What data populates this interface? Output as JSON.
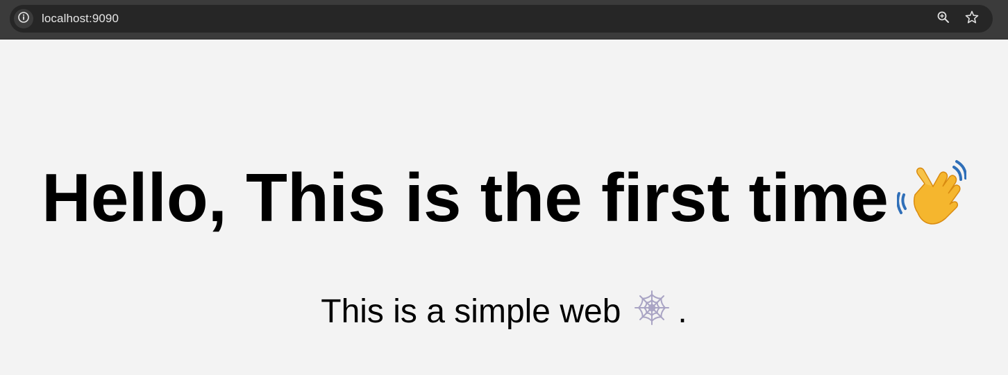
{
  "browser": {
    "url": "localhost:9090",
    "icons": {
      "site_info": "info-icon",
      "zoom": "zoom-in-icon",
      "bookmark": "star-icon"
    }
  },
  "page": {
    "heading": "Hello, This is the first time",
    "heading_emoji": "waving-hand-emoji",
    "subtitle": "This is a simple web",
    "subtitle_emoji": "spider-web-emoji",
    "subtitle_end": "."
  },
  "colors": {
    "background": "#f3f3f3",
    "toolbar": "#3b3b3b",
    "omnibox": "#262626",
    "text": "#000000"
  }
}
